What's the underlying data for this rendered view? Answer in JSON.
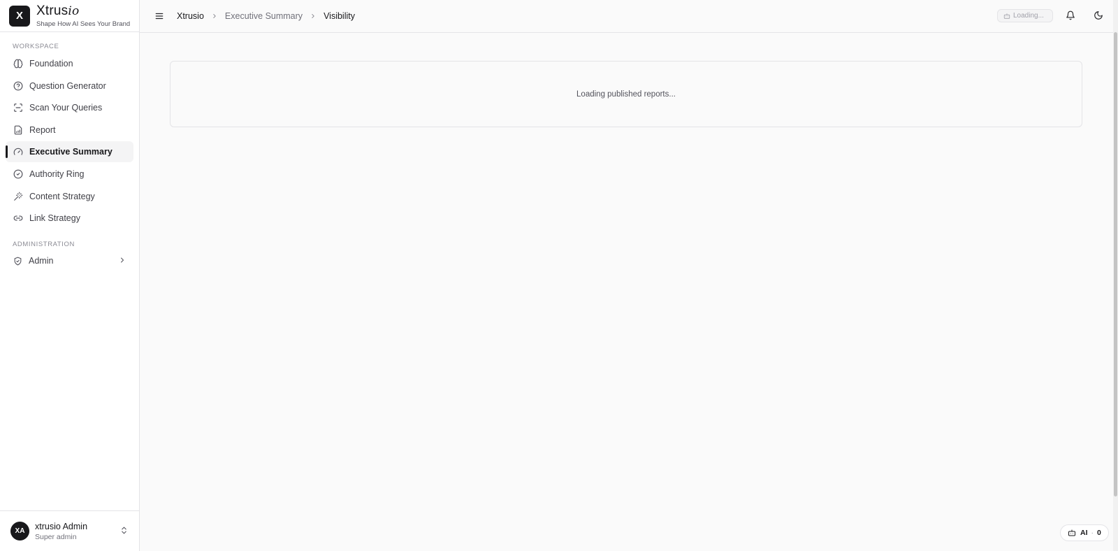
{
  "brand": {
    "logo_letter": "X",
    "name_part1": "Xtrus",
    "name_part2": "io",
    "tagline": "Shape How AI Sees Your Brand"
  },
  "sidebar": {
    "workspace_label": "WORKSPACE",
    "items": [
      {
        "label": "Foundation",
        "icon": "brain-icon"
      },
      {
        "label": "Question Generator",
        "icon": "help-circle-icon"
      },
      {
        "label": "Scan Your Queries",
        "icon": "scan-icon"
      },
      {
        "label": "Report",
        "icon": "file-chart-icon"
      },
      {
        "label": "Executive Summary",
        "icon": "gauge-icon",
        "active": true
      },
      {
        "label": "Authority Ring",
        "icon": "check-circle-icon"
      },
      {
        "label": "Content Strategy",
        "icon": "wand-icon"
      },
      {
        "label": "Link Strategy",
        "icon": "link-icon"
      }
    ],
    "administration_label": "ADMINISTRATION",
    "admin": {
      "label": "Admin",
      "icon": "shield-check-icon"
    }
  },
  "user": {
    "initials": "XA",
    "name": "xtrusio Admin",
    "role": "Super admin"
  },
  "header": {
    "breadcrumb": [
      "Xtrusio",
      "Executive Summary",
      "Visibility"
    ],
    "status_pill": "Loading..."
  },
  "main": {
    "card_text": "Loading published reports..."
  },
  "ai_badge": {
    "label": "AI",
    "count": "0"
  },
  "colors": {
    "accent": "#18181b",
    "background": "#fafafa",
    "border": "#e4e4e7"
  }
}
